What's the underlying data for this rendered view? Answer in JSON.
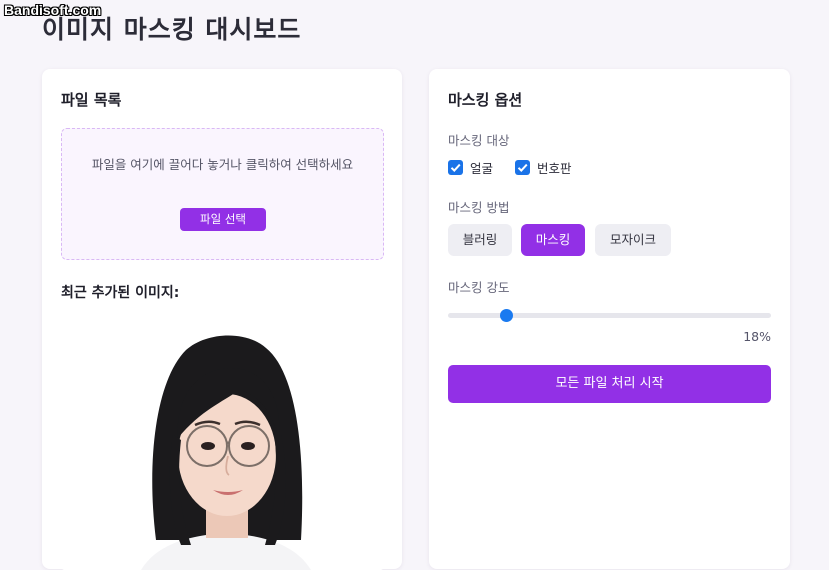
{
  "watermark": "Bandisoft.com",
  "page_title": "이미지 마스킹 대시보드",
  "file_panel": {
    "title": "파일 목록",
    "dropzone_text": "파일을 여기에 끌어다 놓거나 클릭하여 선택하세요",
    "select_button": "파일 선택",
    "recent_title": "최근 추가된 이미지:"
  },
  "options_panel": {
    "title": "마스킹 옵션",
    "target_label": "마스킹 대상",
    "targets": [
      {
        "label": "얼굴",
        "checked": true
      },
      {
        "label": "번호판",
        "checked": true
      }
    ],
    "method_label": "마스킹 방법",
    "methods": [
      {
        "label": "블러링",
        "active": false
      },
      {
        "label": "마스킹",
        "active": true
      },
      {
        "label": "모자이크",
        "active": false
      }
    ],
    "intensity_label": "마스킹 강도",
    "intensity_value": 18,
    "intensity_display": "18%",
    "start_button": "모든 파일 처리 시작"
  },
  "colors": {
    "accent": "#9230e6",
    "slider": "#1a7af0",
    "checkbox": "#1a73e8"
  }
}
